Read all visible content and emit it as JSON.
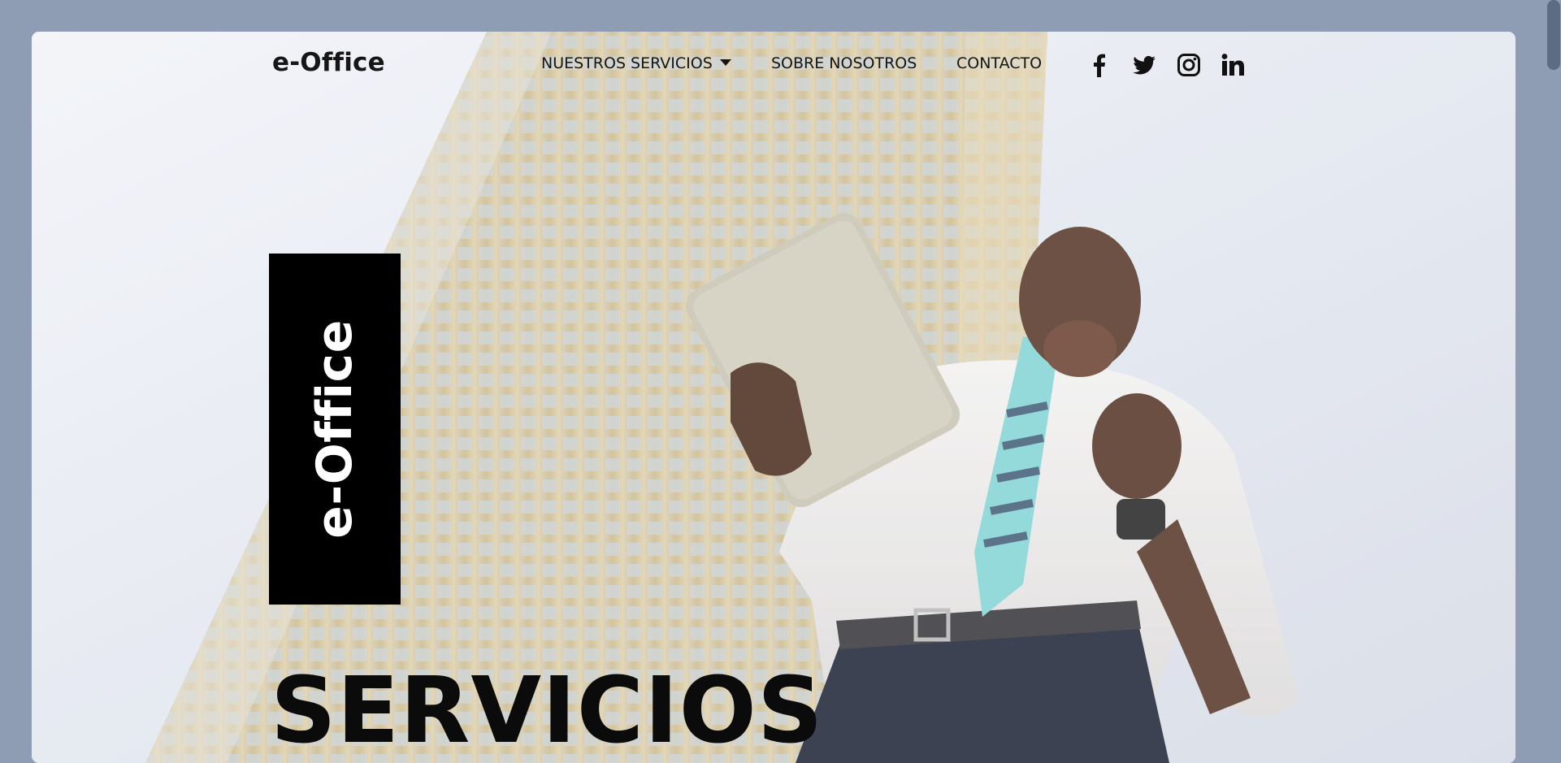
{
  "header": {
    "logo": "e-Office",
    "nav": {
      "services_label": "NUESTROS SERVICIOS",
      "about_label": "SOBRE NOSOTROS",
      "contact_label": "CONTACTO"
    },
    "social": [
      "facebook-icon",
      "twitter-icon",
      "instagram-icon",
      "linkedin-icon"
    ]
  },
  "hero": {
    "badge_text": "e-Office",
    "title": "SERVICIOS"
  },
  "colors": {
    "backdrop": "#8e9cb4",
    "text": "#151515",
    "badge_bg": "#000000",
    "badge_text": "#ffffff"
  }
}
